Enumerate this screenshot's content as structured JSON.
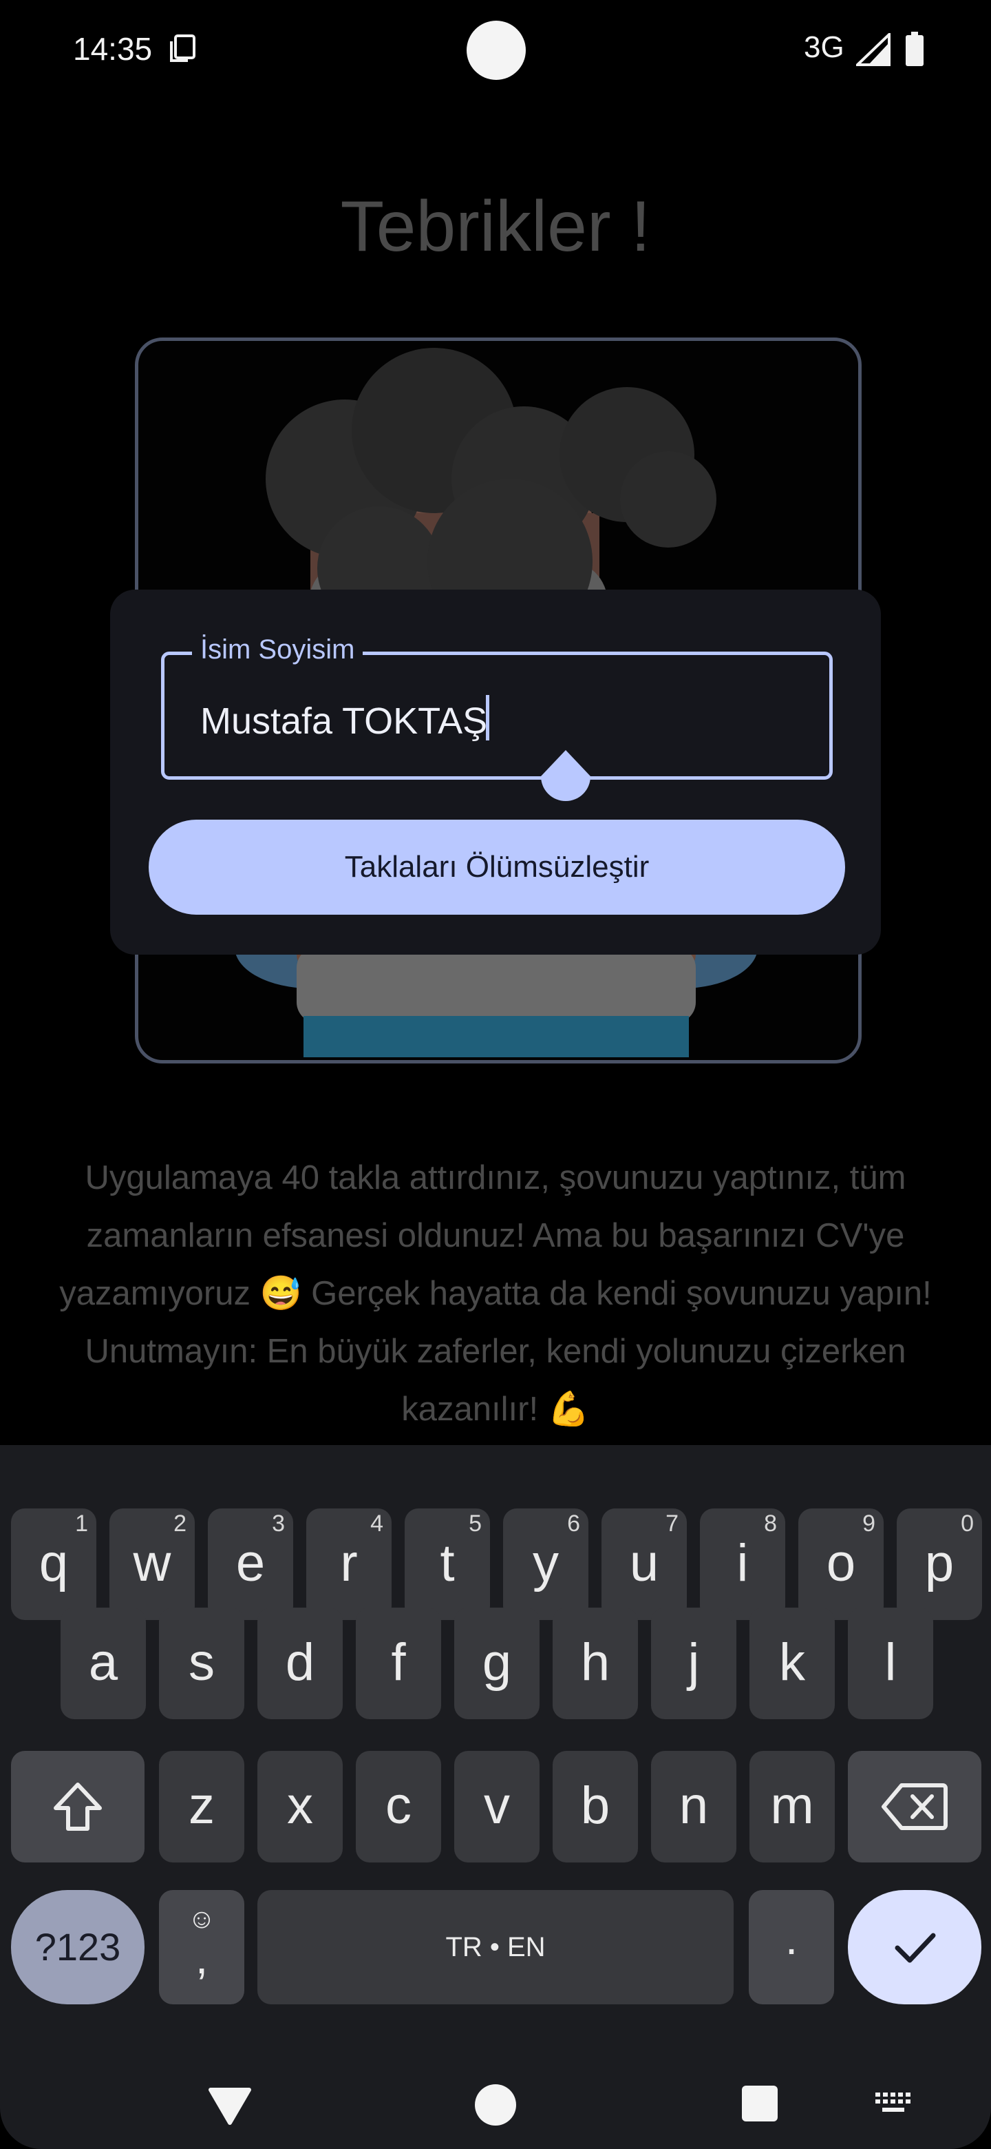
{
  "status_bar": {
    "time": "14:35",
    "network": "3G"
  },
  "screen": {
    "title": "Tebrikler !",
    "message": "Uygulamaya 40 takla attırdınız, şovunuzu yaptınız, tüm zamanların efsanesi oldunuz! Ama bu başarınızı CV'ye yazamıyoruz 😅 Gerçek hayatta da kendi şovunuzu yapın! Unutmayın: En büyük zaferler, kendi yolunuzu çizerken kazanılır! 💪"
  },
  "dialog": {
    "field_label": "İsim Soyisim",
    "field_value": "Mustafa TOKTAŞ",
    "button_label": "Taklaları Ölümsüzleştir"
  },
  "keyboard": {
    "row1": [
      {
        "key": "q",
        "hint": "1"
      },
      {
        "key": "w",
        "hint": "2"
      },
      {
        "key": "e",
        "hint": "3"
      },
      {
        "key": "r",
        "hint": "4"
      },
      {
        "key": "t",
        "hint": "5"
      },
      {
        "key": "y",
        "hint": "6"
      },
      {
        "key": "u",
        "hint": "7"
      },
      {
        "key": "i",
        "hint": "8"
      },
      {
        "key": "o",
        "hint": "9"
      },
      {
        "key": "p",
        "hint": "0"
      }
    ],
    "row2": [
      "a",
      "s",
      "d",
      "f",
      "g",
      "h",
      "j",
      "k",
      "l"
    ],
    "row3": [
      "z",
      "x",
      "c",
      "v",
      "b",
      "n",
      "m"
    ],
    "symbols_label": "?123",
    "emoji_label": "☺",
    "comma_label": ",",
    "space_label": "TR • EN",
    "period_label": ".",
    "shift_icon": "shift-icon",
    "backspace_icon": "backspace-icon",
    "enter_icon": "checkmark-icon"
  },
  "colors": {
    "accent": "#b9c8ff",
    "dialog_bg": "#15161c",
    "keyboard_bg": "#1b1c20",
    "key_bg": "#38393d",
    "muted_text": "#4a4a4a"
  }
}
